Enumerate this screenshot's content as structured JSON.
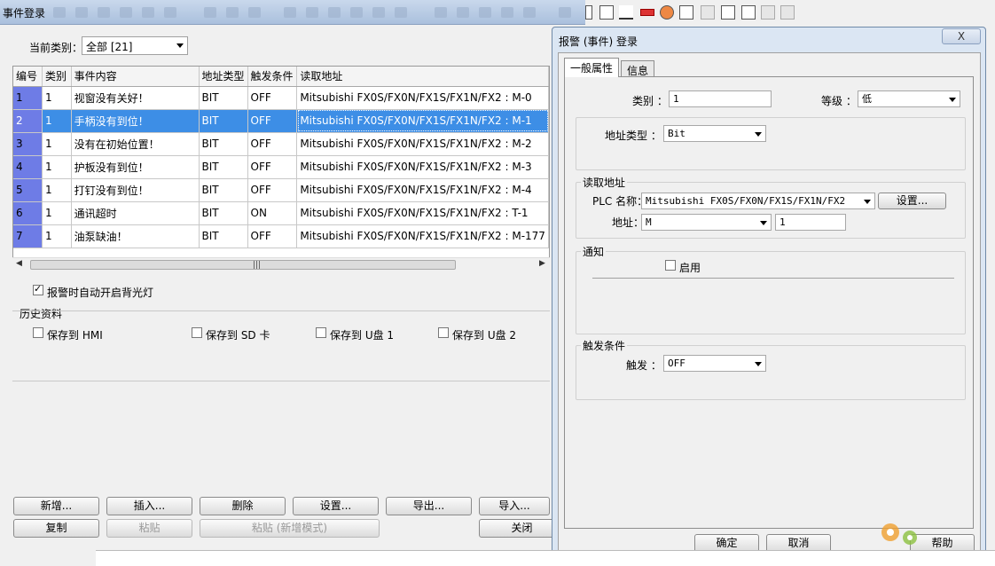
{
  "left_window": {
    "title": "事件登录",
    "category_label": "当前类别：",
    "category_value": "全部 [21]",
    "columns": [
      "编号",
      "类别",
      "事件内容",
      "地址类型",
      "触发条件",
      "读取地址"
    ],
    "rows": [
      {
        "idx": "1",
        "cat": "1",
        "content": "视窗没有关好！",
        "type": "BIT",
        "trigger": "OFF",
        "addr": "Mitsubishi FX0S/FX0N/FX1S/FX1N/FX2 : M-0"
      },
      {
        "idx": "2",
        "cat": "1",
        "content": "手柄没有到位！",
        "type": "BIT",
        "trigger": "OFF",
        "addr": "Mitsubishi FX0S/FX0N/FX1S/FX1N/FX2 : M-1"
      },
      {
        "idx": "3",
        "cat": "1",
        "content": "没有在初始位置！",
        "type": "BIT",
        "trigger": "OFF",
        "addr": "Mitsubishi FX0S/FX0N/FX1S/FX1N/FX2 : M-2"
      },
      {
        "idx": "4",
        "cat": "1",
        "content": "护板没有到位！",
        "type": "BIT",
        "trigger": "OFF",
        "addr": "Mitsubishi FX0S/FX0N/FX1S/FX1N/FX2 : M-3"
      },
      {
        "idx": "5",
        "cat": "1",
        "content": "打钉没有到位！",
        "type": "BIT",
        "trigger": "OFF",
        "addr": "Mitsubishi FX0S/FX0N/FX1S/FX1N/FX2 : M-4"
      },
      {
        "idx": "6",
        "cat": "1",
        "content": "通讯超时",
        "type": "BIT",
        "trigger": "ON",
        "addr": "Mitsubishi FX0S/FX0N/FX1S/FX1N/FX2 : T-1"
      },
      {
        "idx": "7",
        "cat": "1",
        "content": "油泵缺油！",
        "type": "BIT",
        "trigger": "OFF",
        "addr": "Mitsubishi FX0S/FX0N/FX1S/FX1N/FX2 : M-177"
      }
    ],
    "selected_row": 1,
    "backlight_label": "报警时自动开启背光灯",
    "backlight_checked": true,
    "history_label": "历史资料",
    "save_hmi": "保存到 HMI",
    "save_sd": "保存到 SD 卡",
    "save_usb1": "保存到 U盘 1",
    "save_usb2": "保存到 U盘 2",
    "buttons": {
      "new": "新增...",
      "insert": "插入...",
      "delete": "删除",
      "settings": "设置...",
      "export": "导出...",
      "import": "导入...",
      "copy": "复制",
      "paste": "粘贴",
      "paste_new": "粘贴 (新增模式)",
      "close": "关闭"
    }
  },
  "dialog": {
    "title": "报警 (事件) 登录",
    "close_glyph": "X",
    "tabs": [
      "一般属性",
      "信息"
    ],
    "category_label": "类别 ：",
    "category_value": "1",
    "level_label": "等级 ：",
    "level_value": "低",
    "addr_type_label": "地址类型 ：",
    "addr_type_value": "Bit",
    "read_addr_title": "读取地址",
    "plc_label": "PLC 名称：",
    "plc_value": "Mitsubishi FX0S/FX0N/FX1S/FX1N/FX2",
    "plc_settings": "设置...",
    "address_label": "地址：",
    "address_device": "M",
    "address_value": "1",
    "notify_title": "通知",
    "enable_label": "启用",
    "enable_checked": false,
    "trigger_title": "触发条件",
    "trigger_label": "触发 ：",
    "trigger_value": "OFF",
    "ok": "确定",
    "cancel": "取消",
    "help": "帮助"
  },
  "colors": {
    "selected_row": "#3d8ee6",
    "index_column": "#6e7ce6",
    "dialog_frame": "#dbe6f3"
  }
}
